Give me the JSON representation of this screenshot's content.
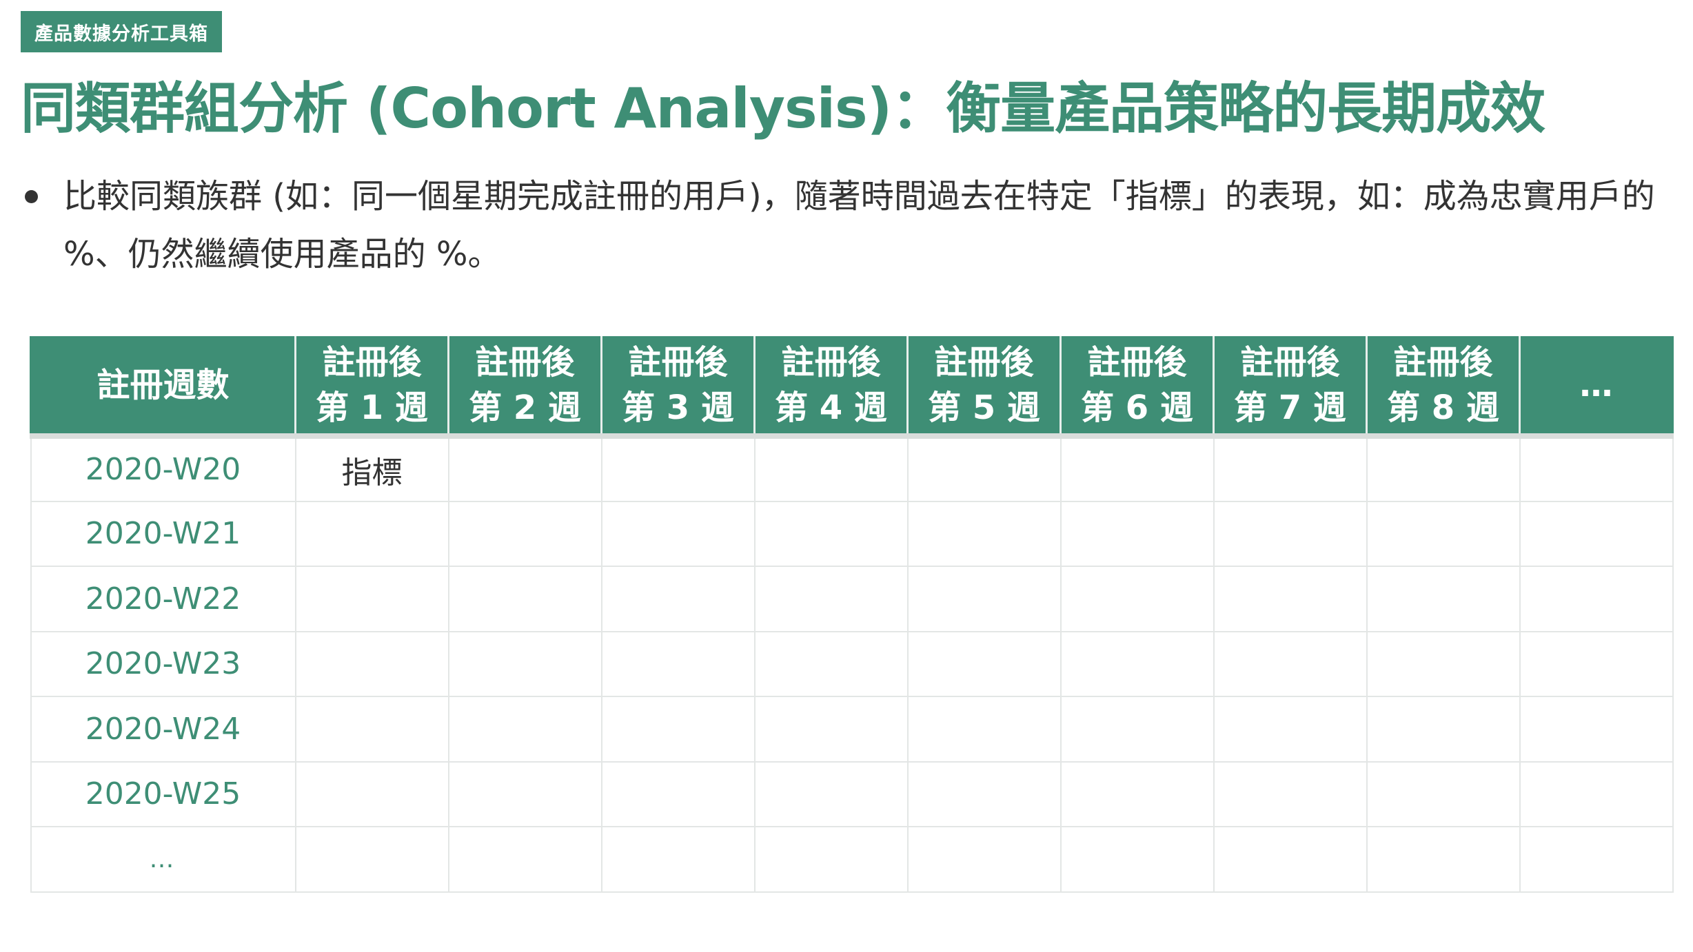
{
  "tag": "產品數據分析工具箱",
  "title": "同類群組分析 (Cohort Analysis)：衡量產品策略的長期成效",
  "bullet": "比較同類族群 (如：同一個星期完成註冊的用戶)，隨著時間過去在特定「指標」的表現，如：成為忠實用戶的 %、仍然繼續使用產品的 %。",
  "table": {
    "corner": "註冊週數",
    "cols": [
      {
        "l1": "註冊後",
        "l2": "第 1 週"
      },
      {
        "l1": "註冊後",
        "l2": "第 2 週"
      },
      {
        "l1": "註冊後",
        "l2": "第 3 週"
      },
      {
        "l1": "註冊後",
        "l2": "第 4 週"
      },
      {
        "l1": "註冊後",
        "l2": "第 5 週"
      },
      {
        "l1": "註冊後",
        "l2": "第 6 週"
      },
      {
        "l1": "註冊後",
        "l2": "第 7 週"
      },
      {
        "l1": "註冊後",
        "l2": "第 8 週"
      }
    ],
    "more": "…",
    "rows": [
      "2020-W20",
      "2020-W21",
      "2020-W22",
      "2020-W23",
      "2020-W24",
      "2020-W25",
      "…"
    ],
    "metric": "指標"
  }
}
